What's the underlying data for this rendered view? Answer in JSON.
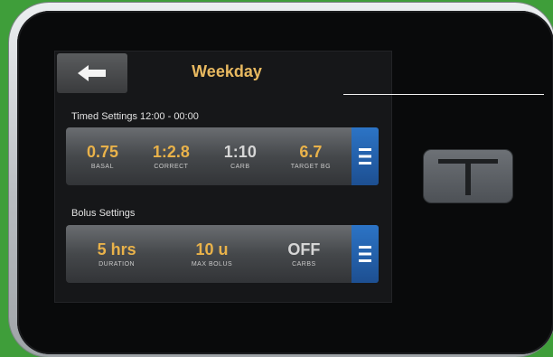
{
  "screen": {
    "title": "Weekday",
    "back_icon": "back-arrow-icon"
  },
  "timed_settings": {
    "label": "Timed Settings 12:00 - 00:00",
    "items": [
      {
        "value": "0.75",
        "label": "BASAL"
      },
      {
        "value": "1:2.8",
        "label": "CORRECT"
      },
      {
        "value": "1:10",
        "label": "CARB"
      },
      {
        "value": "6.7",
        "label": "TARGET BG"
      }
    ],
    "menu_icon": "menu-icon"
  },
  "bolus_settings": {
    "label": "Bolus Settings",
    "items": [
      {
        "value": "5 hrs",
        "label": "DURATION"
      },
      {
        "value": "10 u",
        "label": "MAX BOLUS"
      },
      {
        "value": "OFF",
        "label": "CARBS"
      }
    ],
    "menu_icon": "menu-icon"
  },
  "device": {
    "home_button_icon": "home-t-icon"
  },
  "colors": {
    "background": "#3f9e3a",
    "accent": "#e9b24a",
    "menu_blue": "#2c74c6"
  }
}
